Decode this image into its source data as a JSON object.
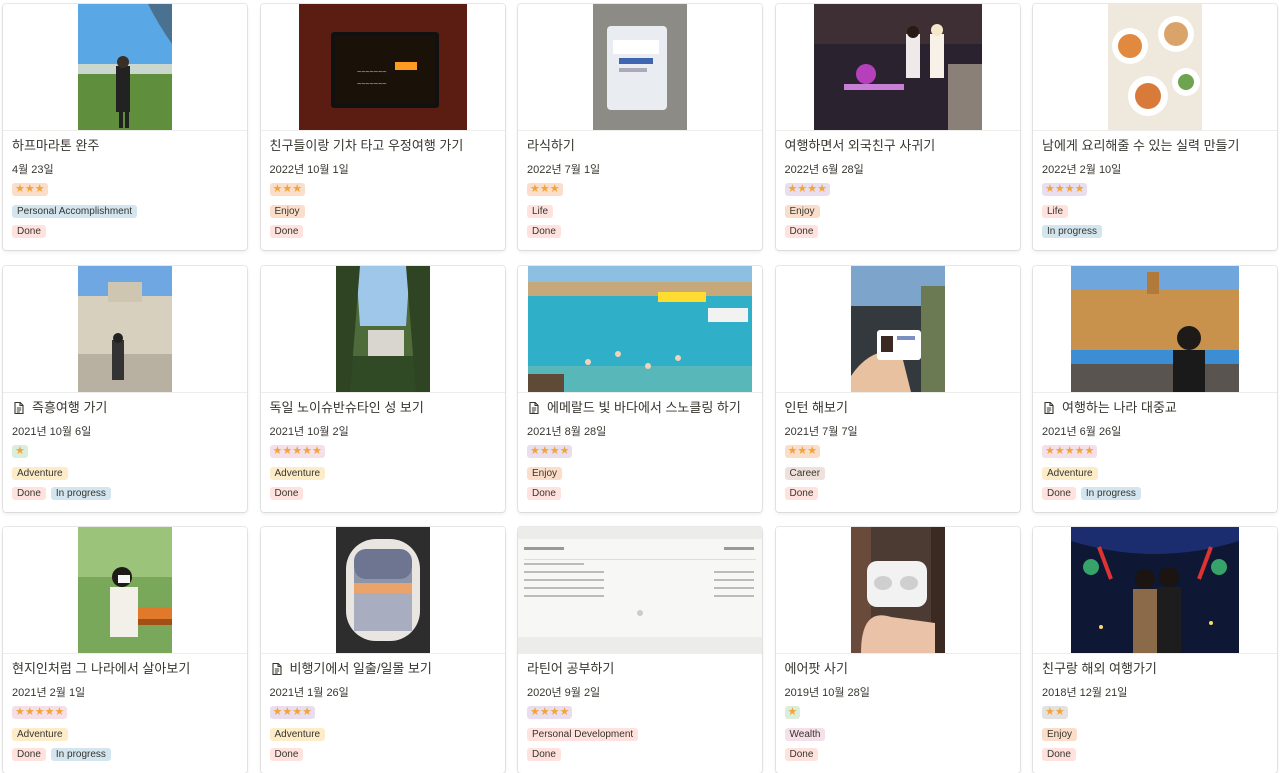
{
  "colors": {
    "star": "#f2a43a",
    "tag_blue": "#d3e5ef",
    "tag_orange": "#fadec9",
    "tag_red": "#ffe2dd",
    "tag_yellow": "#fdecc8",
    "tag_pink": "#f5e0e9",
    "tag_brown": "#eee0da"
  },
  "cards": [
    {
      "title": "하프마라톤 완주",
      "date": "4월 23일",
      "stars": "★★★",
      "icon": false,
      "tags": [
        {
          "label": "Personal Accomplishment",
          "color": "blue"
        }
      ],
      "status": [
        {
          "label": "Done",
          "color": "red"
        }
      ]
    },
    {
      "title": "친구들이랑 기차 타고 우정여행 가기",
      "date": "2022년 10월 1일",
      "stars": "★★★",
      "icon": false,
      "tags": [
        {
          "label": "Enjoy",
          "color": "orange"
        }
      ],
      "status": [
        {
          "label": "Done",
          "color": "red"
        }
      ]
    },
    {
      "title": "라식하기",
      "date": "2022년 7월 1일",
      "stars": "★★★",
      "icon": false,
      "tags": [
        {
          "label": "Life",
          "color": "red"
        }
      ],
      "status": [
        {
          "label": "Done",
          "color": "red"
        }
      ]
    },
    {
      "title": "여행하면서 외국친구 사귀기",
      "date": "2022년 6월 28일",
      "stars": "★★★★",
      "icon": false,
      "tags": [
        {
          "label": "Enjoy",
          "color": "orange"
        }
      ],
      "status": [
        {
          "label": "Done",
          "color": "red"
        }
      ]
    },
    {
      "title": "남에게 요리해줄 수 있는 실력 만들기",
      "date": "2022년 2월 10일",
      "stars": "★★★★",
      "icon": false,
      "tags": [
        {
          "label": "Life",
          "color": "red"
        }
      ],
      "status": [
        {
          "label": "In progress",
          "color": "blue"
        }
      ]
    },
    {
      "title": "즉흥여행 가기",
      "date": "2021년 10월 6일",
      "stars": "★",
      "icon": true,
      "tags": [
        {
          "label": "Adventure",
          "color": "yellow"
        }
      ],
      "status": [
        {
          "label": "Done",
          "color": "red"
        },
        {
          "label": "In progress",
          "color": "blue"
        }
      ]
    },
    {
      "title": "독일 노이슈반슈타인 성 보기",
      "date": "2021년 10월 2일",
      "stars": "★★★★★",
      "icon": false,
      "tags": [
        {
          "label": "Adventure",
          "color": "yellow"
        }
      ],
      "status": [
        {
          "label": "Done",
          "color": "red"
        }
      ]
    },
    {
      "title": "에메랄드 빛 바다에서 스노클링 하기",
      "date": "2021년 8월 28일",
      "stars": "★★★★",
      "icon": true,
      "tags": [
        {
          "label": "Enjoy",
          "color": "orange"
        }
      ],
      "status": [
        {
          "label": "Done",
          "color": "red"
        }
      ]
    },
    {
      "title": "인턴 해보기",
      "date": "2021년 7월 7일",
      "stars": "★★★",
      "icon": false,
      "tags": [
        {
          "label": "Career",
          "color": "brown"
        }
      ],
      "status": [
        {
          "label": "Done",
          "color": "red"
        }
      ]
    },
    {
      "title": "여행하는 나라 대중교",
      "date": "2021년 6월 26일",
      "stars": "★★★★★",
      "icon": true,
      "tags": [
        {
          "label": "Adventure",
          "color": "yellow"
        }
      ],
      "status": [
        {
          "label": "Done",
          "color": "red"
        },
        {
          "label": "In progress",
          "color": "blue"
        }
      ]
    },
    {
      "title": "현지인처럼 그 나라에서 살아보기",
      "date": "2021년 2월 1일",
      "stars": "★★★★★",
      "icon": false,
      "tags": [
        {
          "label": "Adventure",
          "color": "yellow"
        }
      ],
      "status": [
        {
          "label": "Done",
          "color": "red"
        },
        {
          "label": "In progress",
          "color": "blue"
        }
      ]
    },
    {
      "title": "비행기에서 일출/일몰 보기",
      "date": "2021년 1월 26일",
      "stars": "★★★★",
      "icon": true,
      "tags": [
        {
          "label": "Adventure",
          "color": "yellow"
        }
      ],
      "status": [
        {
          "label": "Done",
          "color": "red"
        }
      ]
    },
    {
      "title": "라틴어 공부하기",
      "date": "2020년 9월 2일",
      "stars": "★★★★",
      "icon": false,
      "tags": [
        {
          "label": "Personal Development",
          "color": "red"
        }
      ],
      "status": [
        {
          "label": "Done",
          "color": "red"
        }
      ]
    },
    {
      "title": "에어팟 사기",
      "date": "2019년 10월 28일",
      "stars": "★",
      "icon": false,
      "tags": [
        {
          "label": "Wealth",
          "color": "pink"
        }
      ],
      "status": [
        {
          "label": "Done",
          "color": "red"
        }
      ]
    },
    {
      "title": "친구랑 해외 여행가기",
      "date": "2018년 12월 21일",
      "stars": "★★",
      "icon": false,
      "tags": [
        {
          "label": "Enjoy",
          "color": "orange"
        }
      ],
      "status": [
        {
          "label": "Done",
          "color": "red"
        }
      ]
    }
  ]
}
